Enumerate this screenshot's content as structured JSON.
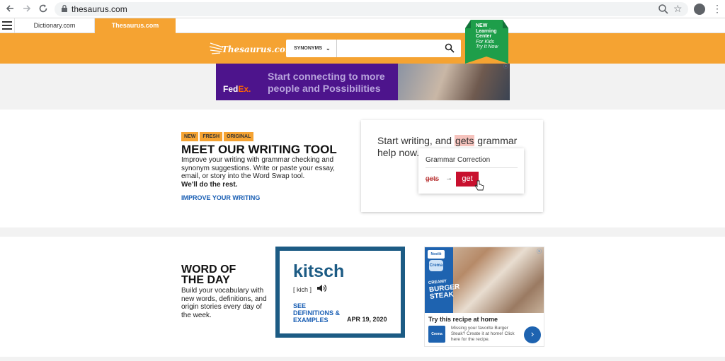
{
  "browser": {
    "url": "thesaurus.com",
    "back_icon": "arrow-left-icon",
    "forward_icon": "arrow-right-icon",
    "reload_icon": "reload-icon"
  },
  "tabs": [
    {
      "label": "Dictionary.com",
      "active": false
    },
    {
      "label": "Thesaurus.com",
      "active": true
    }
  ],
  "header": {
    "logo_text": "Thesaurus.com",
    "search_select": "SYNONYMS",
    "search_placeholder": "",
    "accent_color": "#f5a332"
  },
  "ribbon": {
    "line1": "NEW",
    "line2": "Learning",
    "line3": "Center",
    "line4": "For Kids",
    "line5": "Try It Now"
  },
  "fedex_ad": {
    "logo_fed": "Fed",
    "logo_ex": "Ex.",
    "message": "Start connecting to more people and Possibilities"
  },
  "writing_tool": {
    "badges": [
      "NEW",
      "FRESH",
      "ORIGINAL"
    ],
    "title": "MEET OUR WRITING TOOL",
    "body": "Improve your writing with grammar checking and synonym suggestions. Write or paste your essay, email, or story into the Word Swap tool.",
    "body_bold": "We'll do the rest.",
    "link": "IMPROVE YOUR WRITING",
    "demo_pre": "Start writing, and ",
    "demo_highlight": "gets",
    "demo_post": " grammar help now.",
    "popup_title": "Grammar Correction",
    "popup_old": "gets",
    "popup_arrow": "→",
    "popup_new": "get"
  },
  "word_of_day": {
    "title": "WORD OF THE DAY",
    "body": "Build your vocabulary with new words, definitions, and origin stories every day of the week.",
    "word": "kitsch",
    "pronunciation": "[ kich ]",
    "link": "SEE DEFINITIONS & EXAMPLES",
    "date": "APR 19, 2020"
  },
  "nestle_ad": {
    "brand": "Nestlé",
    "sub_brand": "Crema",
    "product_small": "CREAMY",
    "product": "BURGER STEAK",
    "headline": "Try this recipe at home",
    "copy": "Missing your favorite Burger Steak? Create it at home! Click here for the recipe.",
    "next": "›"
  }
}
